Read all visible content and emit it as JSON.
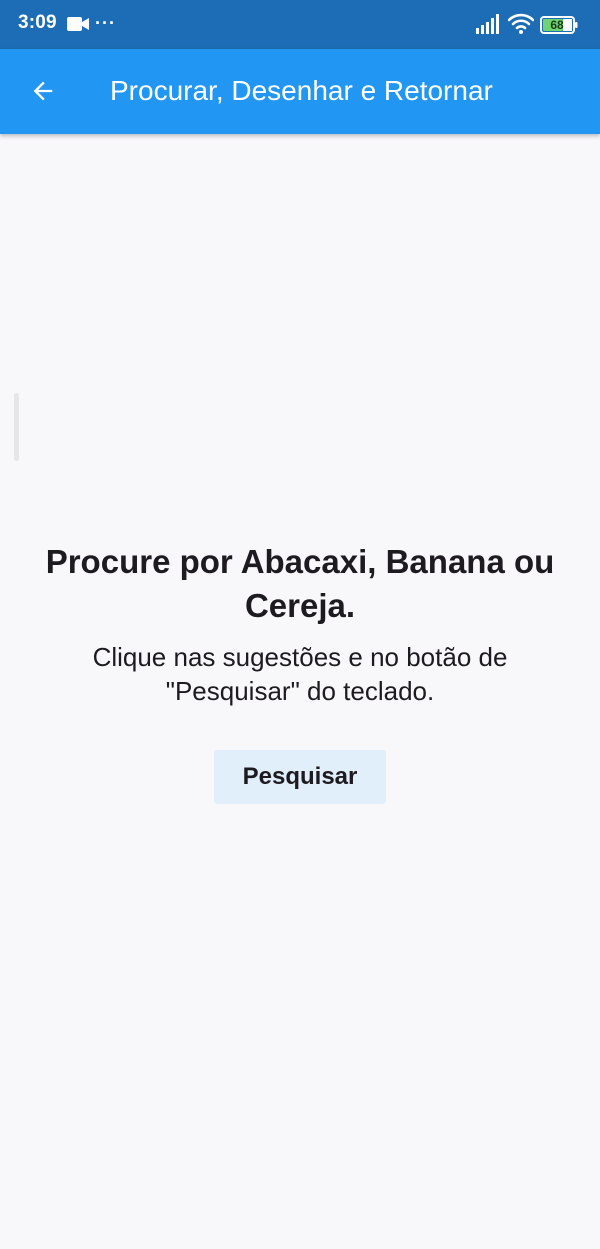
{
  "status_bar": {
    "time": "3:09",
    "more_indicator": "···",
    "battery_level": "68",
    "icons": [
      "video-icon",
      "more-dots-icon",
      "signal-icon",
      "wifi-icon",
      "battery-icon"
    ],
    "background_color": "#1c6db5"
  },
  "app_bar": {
    "title": "Procurar, Desenhar e Retornar",
    "back_icon": "arrow-back-icon",
    "background_color": "#2196f3"
  },
  "main": {
    "heading": "Procure por Abacaxi, Banana ou Cereja.",
    "instruction": "Clique nas sugestões e no botão de \"Pesquisar\" do teclado.",
    "search_button_label": "Pesquisar",
    "button_background_color": "#e1effa",
    "background_color": "#f8f7fa"
  }
}
